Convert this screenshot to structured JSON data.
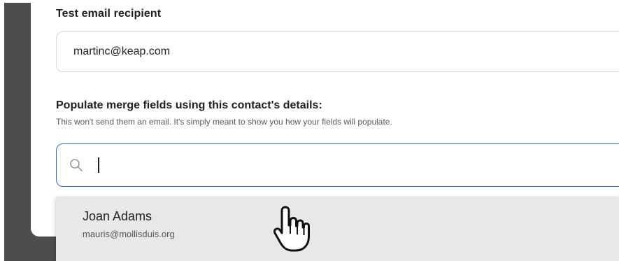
{
  "test_email": {
    "label": "Test email recipient",
    "value": "martinc@keap.com"
  },
  "populate": {
    "title": "Populate merge fields using this contact's details:",
    "subtitle": "This won't send them an email. It's simply meant to show you how your fields will populate.",
    "search_value": ""
  },
  "dropdown": {
    "items": [
      {
        "name": "Joan Adams",
        "email": "mauris@mollisduis.org"
      }
    ]
  },
  "colors": {
    "focus_border": "#2f6fbf",
    "backdrop": "#4d4d4d",
    "dropdown_bg": "#e8e8e8"
  },
  "icons": {
    "search": "search-icon",
    "cursor": "hand-pointer-icon"
  }
}
